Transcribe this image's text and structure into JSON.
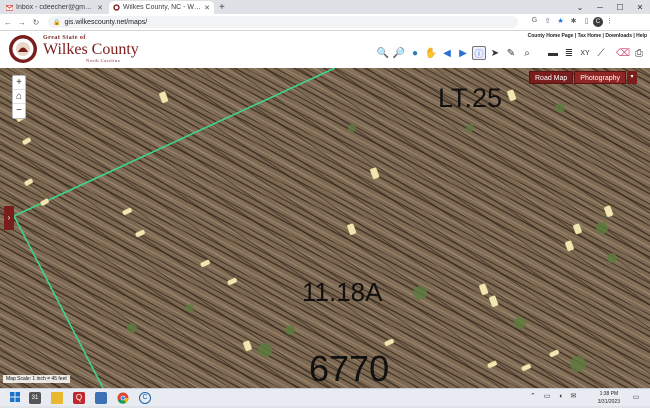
{
  "browser": {
    "tabs": [
      {
        "label": "Inbox - cdeecher@gmail.com - Gm",
        "active": false
      },
      {
        "label": "Wilkes County, NC - Web Map Vi",
        "active": true
      }
    ],
    "new_tab": "+",
    "url": "gis.wilkescounty.net/maps/",
    "profile_initial": "C"
  },
  "site": {
    "title_top": "Great State of",
    "county_name": "Wilkes County",
    "county_sub": "North Carolina",
    "top_links": "County Home Page | Tax Home | Downloads | Help"
  },
  "map": {
    "zoom_in": "+",
    "home": "⌂",
    "zoom_out": "−",
    "side_toggle": "›",
    "basemaps": {
      "road": "Road Map",
      "photo": "Photography",
      "menu": "▾"
    },
    "labels": {
      "lot": "LT.25",
      "acreage": "11.18A",
      "parcel": "6770"
    },
    "scale": "Map Scale: 1 inch = 45 feet"
  },
  "taskbar": {
    "time": "1:38 PM",
    "date": "3/31/2023"
  },
  "colors": {
    "brand": "#7a1d1d",
    "parcel_line": "#3fd48a",
    "aerial_base": "#7a6550"
  }
}
